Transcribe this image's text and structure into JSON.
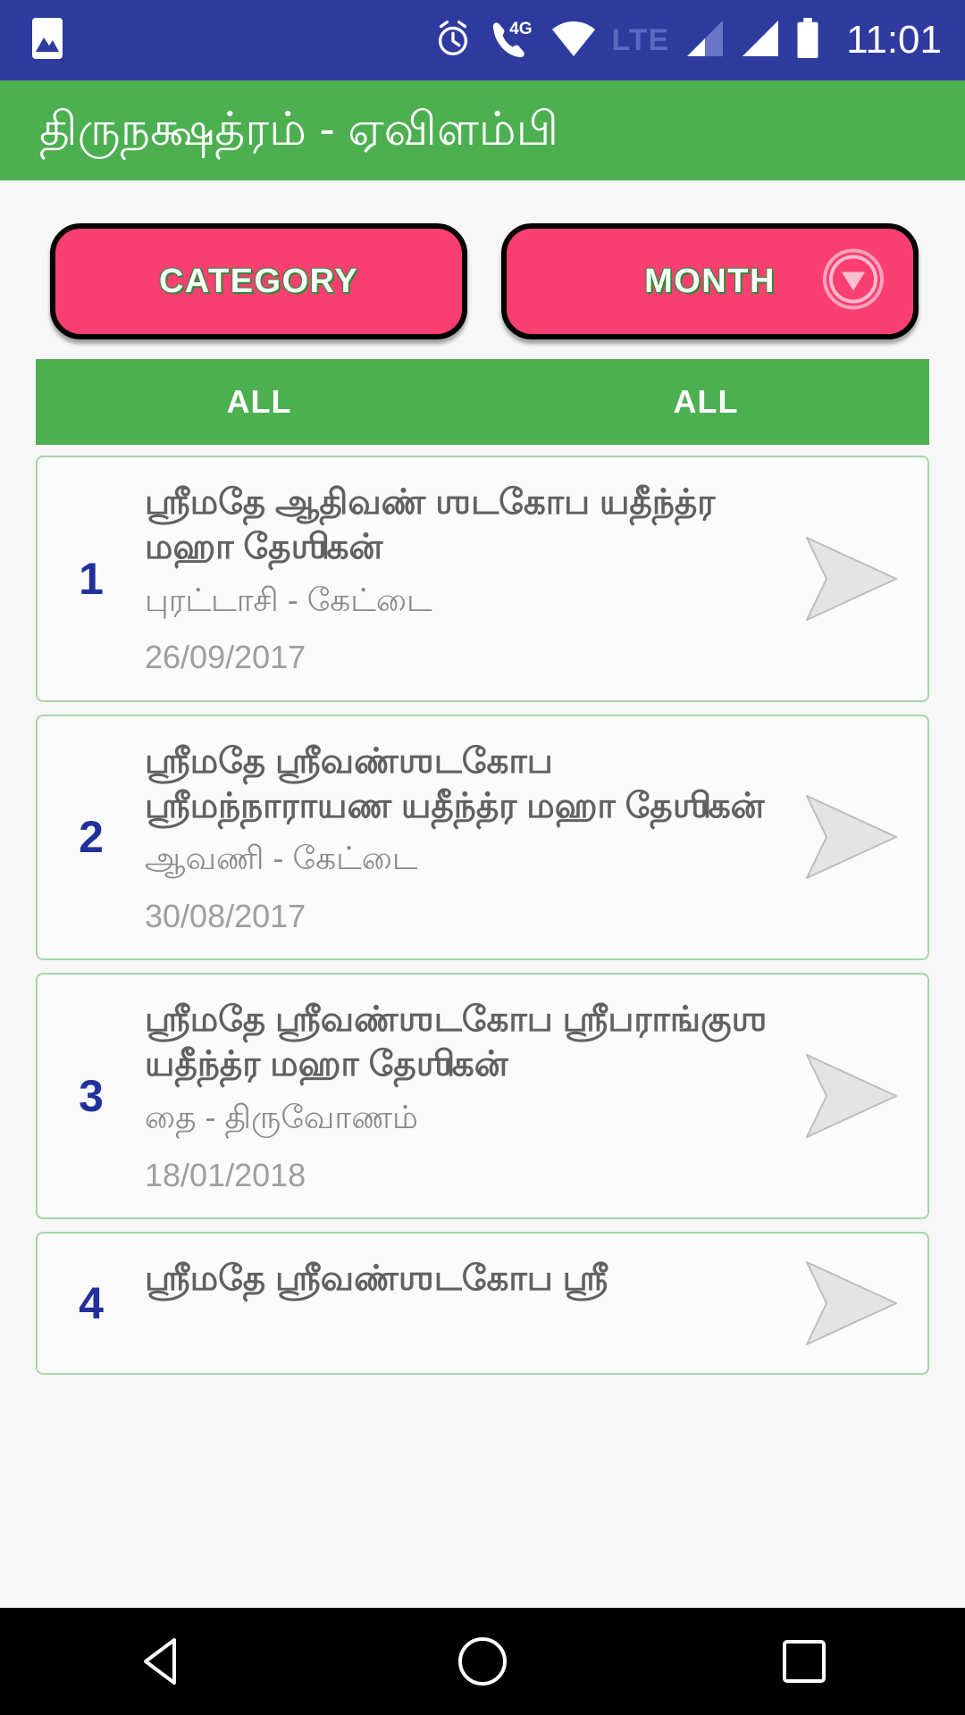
{
  "status_bar": {
    "icons_left": [
      "image-icon"
    ],
    "icons_right": [
      "alarm-icon",
      "call-4g-icon",
      "wifi-icon",
      "lte-label",
      "signal-1-icon",
      "signal-2-icon",
      "battery-icon"
    ],
    "lte_label": "LTE",
    "time": "11:01",
    "background_color": "#2e3a9e"
  },
  "app_bar": {
    "title": "திருநக்ஷத்ரம் - ஏவிளம்பி",
    "background_color": "#4caf50"
  },
  "filters": {
    "category_button": {
      "label": "CATEGORY",
      "selected_value": "ALL",
      "icon": ""
    },
    "month_button": {
      "label": "MONTH",
      "selected_value": "ALL",
      "icon": "chevron-down-circle-icon"
    },
    "button_color": "#fc3f71",
    "bar_color": "#4caf50"
  },
  "list": {
    "items": [
      {
        "index": "1",
        "title": "ஶ்ரீமதே ஆதிவண் ஶடகோப யதீந்த்ர மஹா தேஶிகன்",
        "subtitle": "புரட்டாசி - கேட்டை",
        "date": "26/09/2017",
        "arrow": "play-arrow-icon"
      },
      {
        "index": "2",
        "title": "ஶ்ரீமதே ஶ்ரீவண்ஶடகோப ஶ்ரீமந்நாராயண யதீந்த்ர மஹா தேஶிகன்",
        "subtitle": "ஆவணி - கேட்டை",
        "date": "30/08/2017",
        "arrow": "play-arrow-icon"
      },
      {
        "index": "3",
        "title": "ஶ்ரீமதே ஶ்ரீவண்ஶடகோப ஶ்ரீபராங்குஶ யதீந்த்ர மஹா தேஶிகன்",
        "subtitle": "தை - திருவோணம்",
        "date": "18/01/2018",
        "arrow": "play-arrow-icon"
      },
      {
        "index": "4",
        "title": "ஶ்ரீமதே ஶ்ரீவண்ஶடகோப ஶ்ரீ",
        "subtitle": "",
        "date": "",
        "arrow": "play-arrow-icon"
      }
    ]
  },
  "nav_bar": {
    "buttons": [
      "back-triangle-icon",
      "home-circle-icon",
      "recents-square-icon"
    ],
    "background_color": "#000000"
  }
}
